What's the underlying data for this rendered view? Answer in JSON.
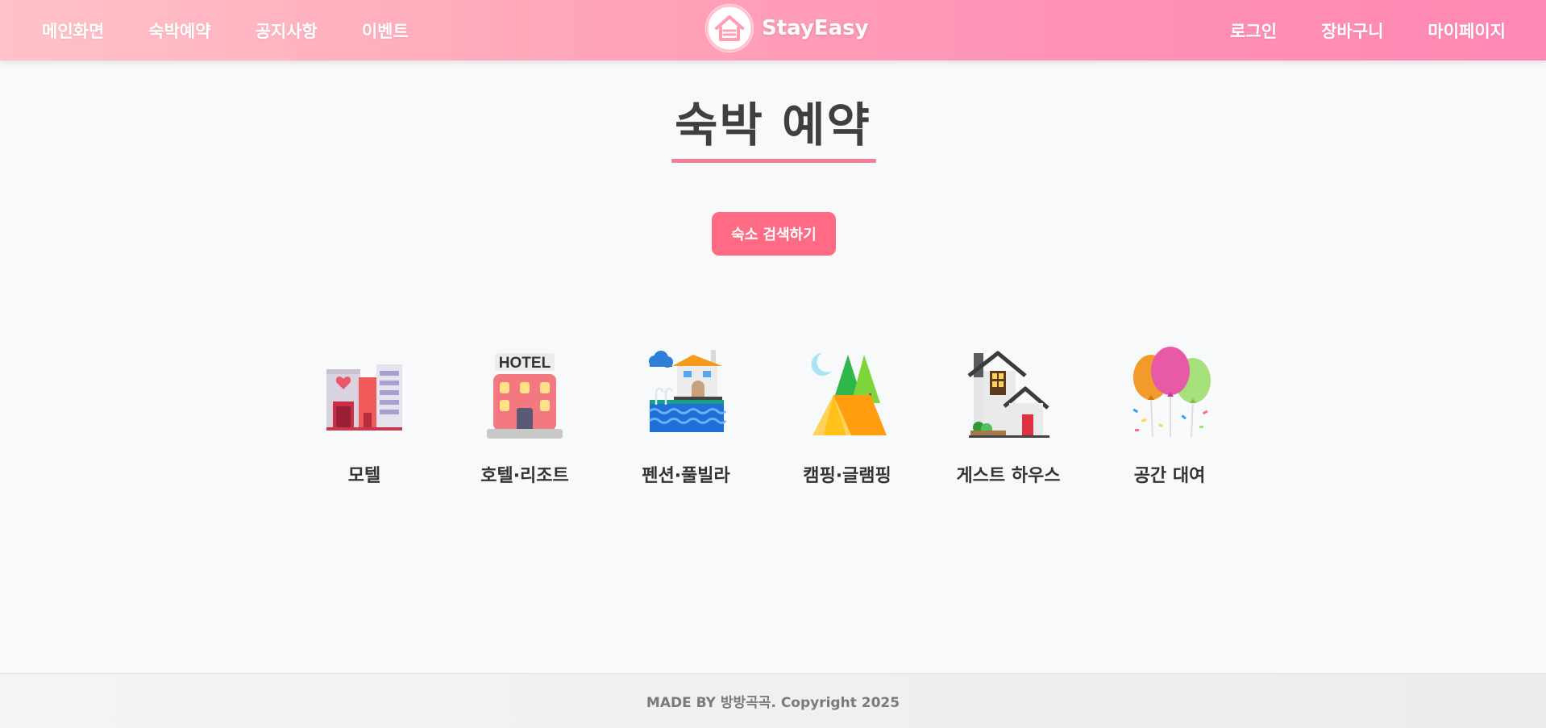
{
  "header": {
    "nav_left": [
      "메인화면",
      "숙박예약",
      "공지사항",
      "이벤트"
    ],
    "logo_text": "StayEasy",
    "nav_right": [
      "로그인",
      "장바구니",
      "마이페이지"
    ]
  },
  "main": {
    "title": "숙박 예약",
    "search_button": "숙소 검색하기",
    "categories": [
      {
        "label": "모텔",
        "icon": "motel-icon"
      },
      {
        "label": "호텔·리조트",
        "icon": "hotel-icon",
        "sign_text": "HOTEL"
      },
      {
        "label": "펜션·풀빌라",
        "icon": "pool-villa-icon"
      },
      {
        "label": "캠핑·글램핑",
        "icon": "camping-tent-icon"
      },
      {
        "label": "게스트 하우스",
        "icon": "guest-house-icon"
      },
      {
        "label": "공간 대여",
        "icon": "balloons-icon"
      }
    ]
  },
  "footer": {
    "text": "MADE BY 방방곡곡. Copyright 2025"
  },
  "colors": {
    "header_gradient_start": "#ffc2c8",
    "header_gradient_end": "#ff88b4",
    "accent": "#ff6b85",
    "underline": "#f27d98"
  }
}
